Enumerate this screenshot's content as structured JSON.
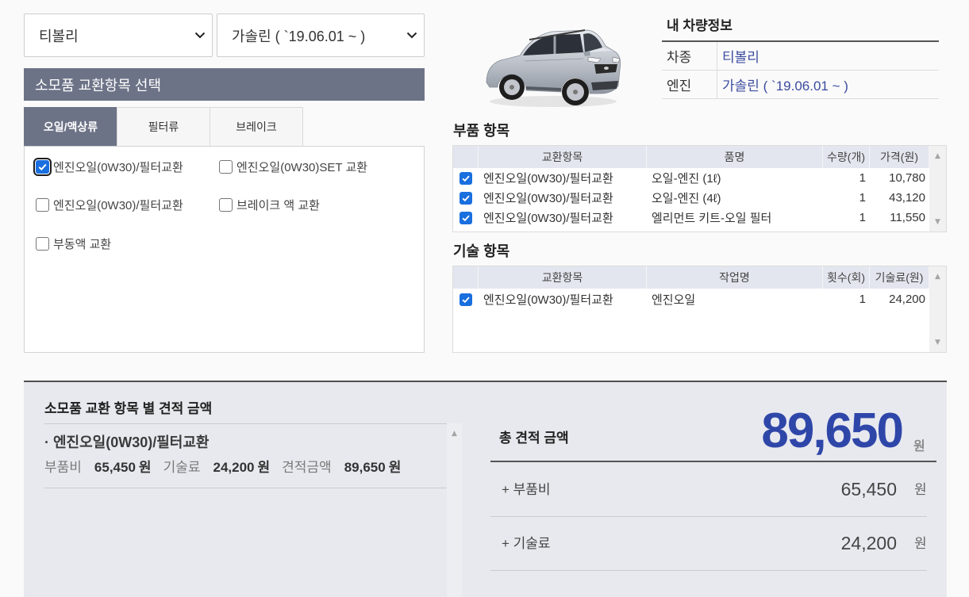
{
  "selects": {
    "model": "티볼리",
    "engine": "가솔린 ( `19.06.01 ~ )"
  },
  "consumables": {
    "title": "소모품 교환항목 선택",
    "tabs": [
      {
        "label": "오일/액상류",
        "selected": true
      },
      {
        "label": "필터류",
        "selected": false
      },
      {
        "label": "브레이크",
        "selected": false
      }
    ],
    "items": [
      {
        "label": "엔진오일(0W30)/필터교환",
        "checked": true
      },
      {
        "label": "엔진오일(0W30)SET 교환",
        "checked": false
      },
      {
        "label": "엔진오일(0W30)/필터교환",
        "checked": false
      },
      {
        "label": "브레이크 액 교환",
        "checked": false
      },
      {
        "label": "부동액 교환",
        "checked": false
      }
    ]
  },
  "vehicle_info": {
    "title": "내 차량정보",
    "rows": [
      {
        "label": "차종",
        "value": "티볼리"
      },
      {
        "label": "엔진",
        "value": "가솔린 ( `19.06.01 ~ )"
      }
    ]
  },
  "parts": {
    "title": "부품 항목",
    "headers": [
      "교환항목",
      "품명",
      "수량(개)",
      "가격(원)"
    ],
    "rows": [
      {
        "checked": true,
        "item": "엔진오일(0W30)/필터교환",
        "name": "오일-엔진 (1ℓ)",
        "qty": "1",
        "price": "10,780"
      },
      {
        "checked": true,
        "item": "엔진오일(0W30)/필터교환",
        "name": "오일-엔진 (4ℓ)",
        "qty": "1",
        "price": "43,120"
      },
      {
        "checked": true,
        "item": "엔진오일(0W30)/필터교환",
        "name": "엘리먼트 키트-오일 필터",
        "qty": "1",
        "price": "11,550"
      }
    ]
  },
  "tech": {
    "title": "기술 항목",
    "headers": [
      "교환항목",
      "작업명",
      "횟수(회)",
      "기술료(원)"
    ],
    "rows": [
      {
        "checked": true,
        "item": "엔진오일(0W30)/필터교환",
        "work": "엔진오일",
        "count": "1",
        "fee": "24,200"
      }
    ]
  },
  "summary": {
    "title": "소모품 교환 항목 별 견적 금액",
    "items": [
      {
        "name": "· 엔진오일(0W30)/필터교환",
        "parts_label": "부품비",
        "parts_value": "65,450",
        "tech_label": "기술료",
        "tech_value": "24,200",
        "estimate_label": "견적금액",
        "estimate_value": "89,650",
        "unit": "원"
      }
    ]
  },
  "total": {
    "title": "총 견적 금액",
    "amount": "89,650",
    "unit": "원",
    "breakdown": [
      {
        "label": "+ 부품비",
        "value": "65,450",
        "unit": "원"
      },
      {
        "label": "+ 기술료",
        "value": "24,200",
        "unit": "원"
      }
    ]
  },
  "icons": {
    "select_arrow": "chevron-down-icon",
    "checkbox_mark": "check-icon",
    "scroll_up": "scroll-up-arrow-icon",
    "scroll_down": "scroll-down-arrow-icon",
    "scroll_up_glyph": "▲",
    "scroll_down_glyph": "▼"
  },
  "colors": {
    "category_header": "#6d7387",
    "selected_tab": "#6d7387",
    "table_header": "#e3e6ee",
    "checkbox_checked": "#1a6fdf",
    "vehicle_value": "#3b4b9e",
    "total_amount": "#2f46a9",
    "summary_background": "#e8e9ef"
  }
}
